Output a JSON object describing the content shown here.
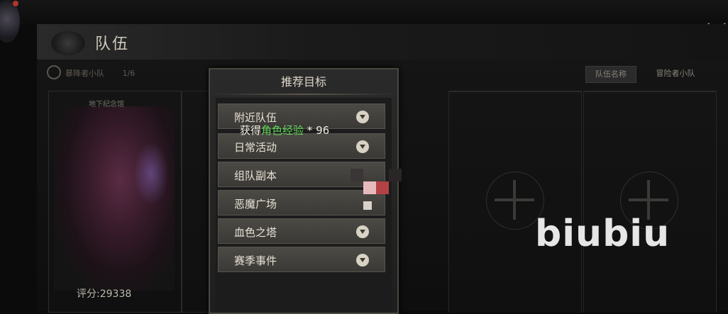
{
  "header": {
    "title": "队伍"
  },
  "subheader": {
    "team_label": "暴降者小队",
    "team_count": "1/6",
    "tabs": [
      {
        "label": "队伍名称",
        "active": true
      },
      {
        "label": "冒险者小队",
        "active": false
      }
    ]
  },
  "member": {
    "name": "地下纪念馆",
    "power": "评分:29338"
  },
  "dropdown": {
    "title": "推荐目标",
    "options": [
      {
        "label": "附近队伍"
      },
      {
        "label": "日常活动"
      },
      {
        "label": "组队副本"
      },
      {
        "label": "恶魔广场"
      },
      {
        "label": "血色之塔"
      },
      {
        "label": "赛季事件"
      }
    ]
  },
  "tooltip": {
    "prefix": "获得",
    "highlight": "角色经验",
    "suffix": " * 96"
  },
  "watermark": "biubiu",
  "colors": {
    "highlight_green": "#62d45a",
    "background": "#0b0b0c"
  }
}
